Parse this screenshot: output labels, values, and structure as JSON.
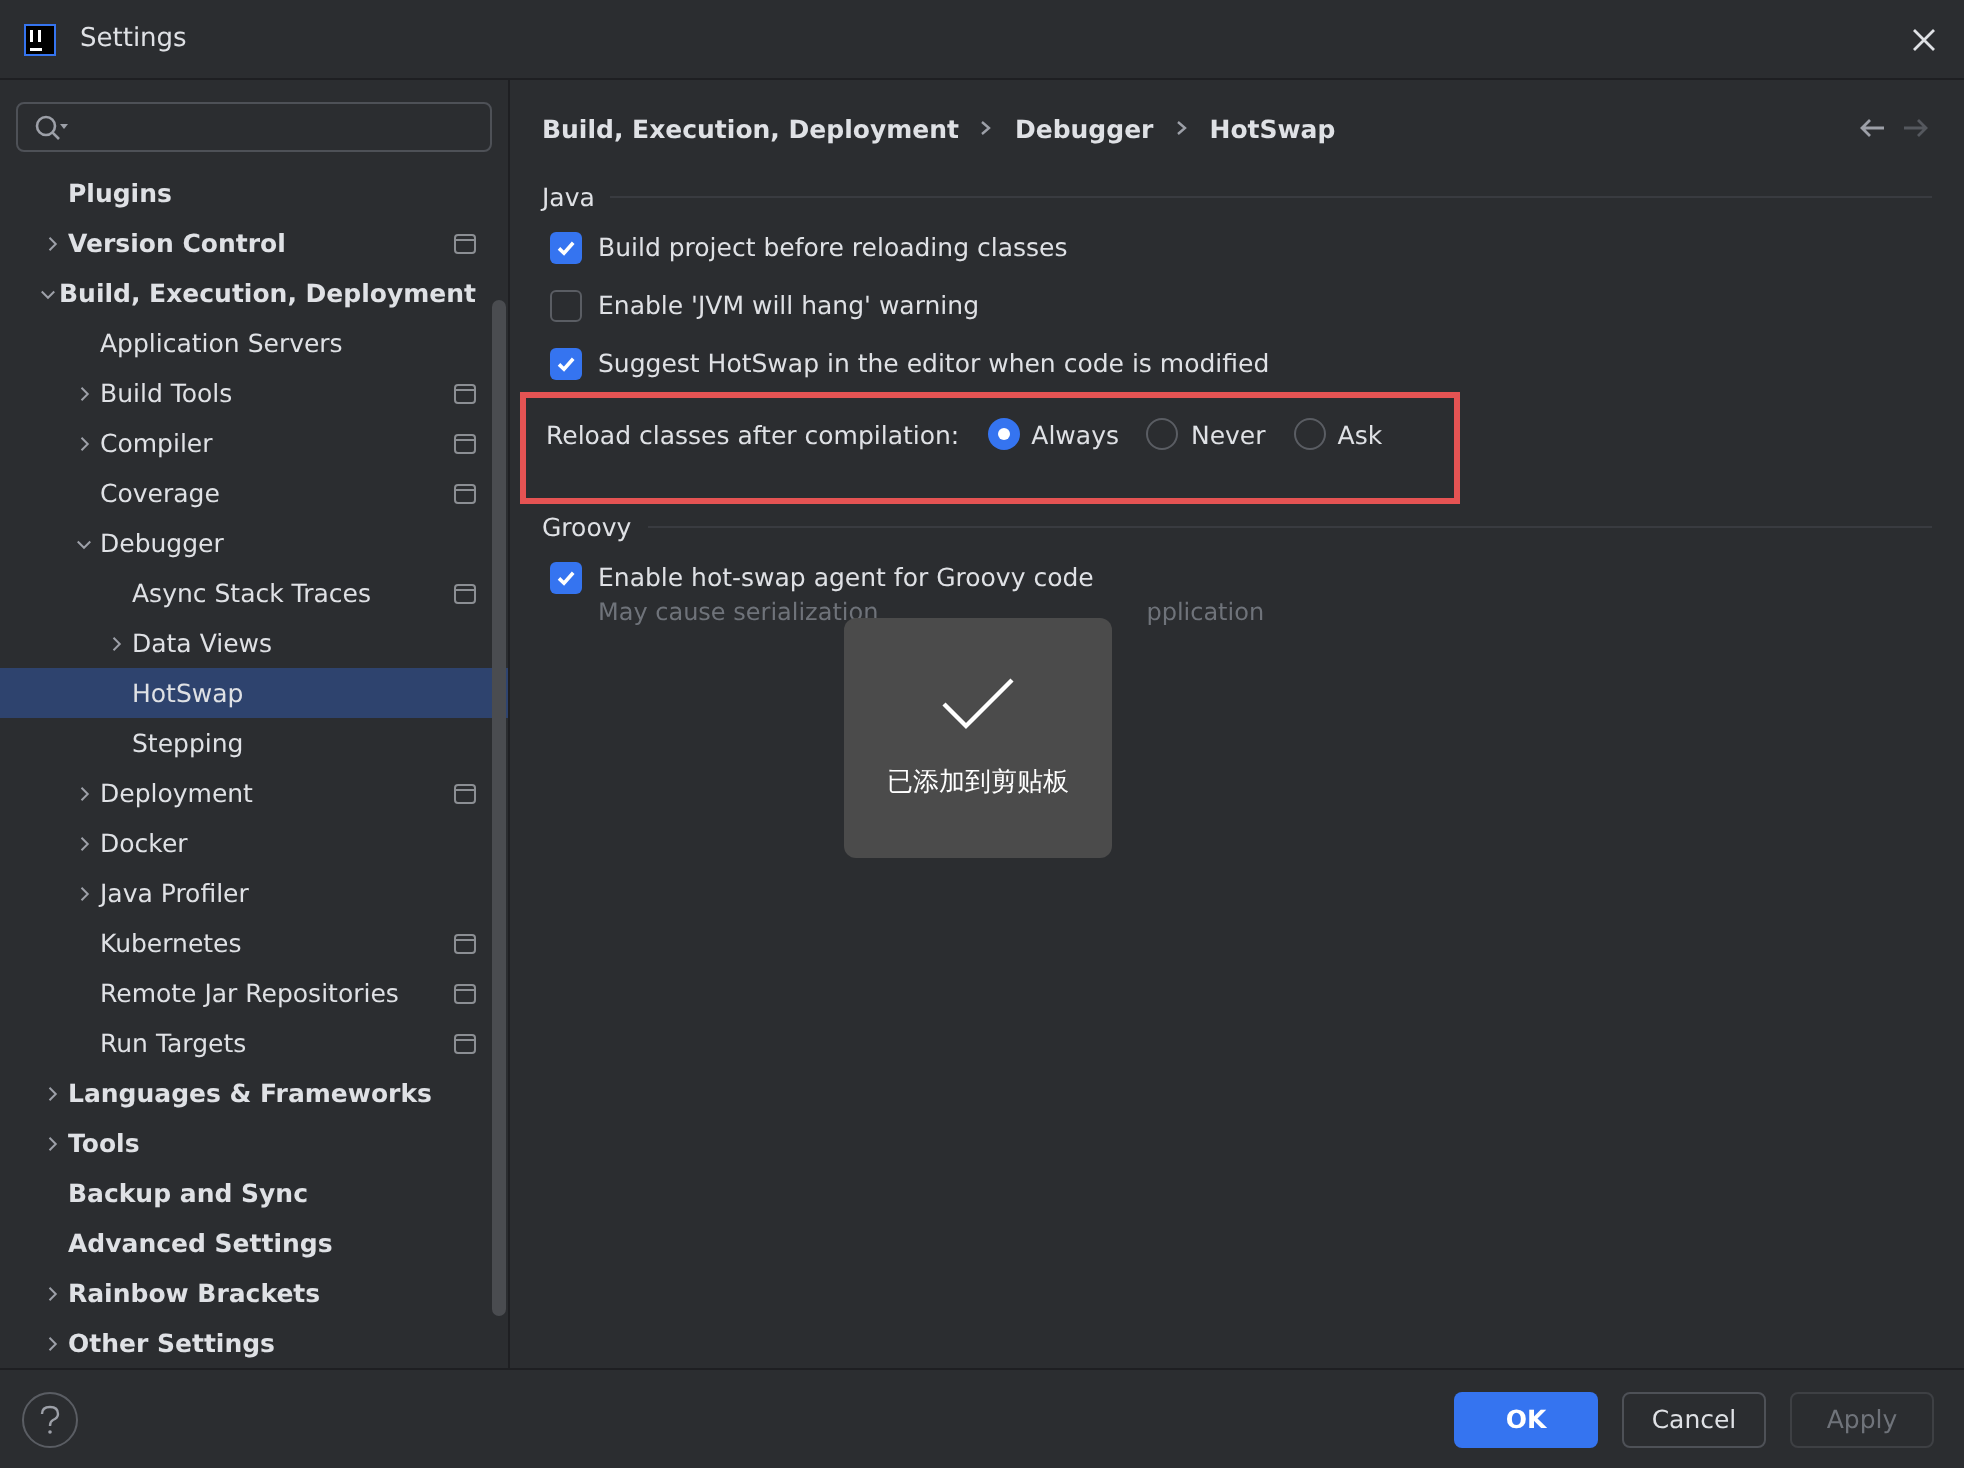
{
  "window": {
    "title": "Settings"
  },
  "sidebar": {
    "items": [
      {
        "label": "Plugins",
        "selected": false
      },
      {
        "label": "Version Control",
        "selected": false,
        "scoped": true,
        "expanded": false
      },
      {
        "label": "Build, Execution, Deployment",
        "selected": false,
        "expanded": true,
        "children": [
          {
            "label": "Application Servers",
            "selected": false
          },
          {
            "label": "Build Tools",
            "selected": false,
            "scoped": true,
            "expanded": false
          },
          {
            "label": "Compiler",
            "selected": false,
            "scoped": true,
            "expanded": false
          },
          {
            "label": "Coverage",
            "selected": false,
            "scoped": true
          },
          {
            "label": "Debugger",
            "selected": false,
            "expanded": true,
            "children": [
              {
                "label": "Async Stack Traces",
                "selected": false,
                "scoped": true
              },
              {
                "label": "Data Views",
                "selected": false,
                "expanded": false
              },
              {
                "label": "HotSwap",
                "selected": true
              },
              {
                "label": "Stepping",
                "selected": false
              }
            ]
          },
          {
            "label": "Deployment",
            "selected": false,
            "scoped": true,
            "expanded": false
          },
          {
            "label": "Docker",
            "selected": false,
            "expanded": false
          },
          {
            "label": "Java Profiler",
            "selected": false,
            "expanded": false
          },
          {
            "label": "Kubernetes",
            "selected": false,
            "scoped": true
          },
          {
            "label": "Remote Jar Repositories",
            "selected": false,
            "scoped": true
          },
          {
            "label": "Run Targets",
            "selected": false,
            "scoped": true
          }
        ]
      },
      {
        "label": "Languages & Frameworks",
        "selected": false,
        "expanded": false
      },
      {
        "label": "Tools",
        "selected": false,
        "expanded": false
      },
      {
        "label": "Backup and Sync",
        "selected": false
      },
      {
        "label": "Advanced Settings",
        "selected": false
      },
      {
        "label": "Rainbow Brackets",
        "selected": false,
        "expanded": false
      },
      {
        "label": "Other Settings",
        "selected": false,
        "expanded": false
      }
    ]
  },
  "breadcrumb": [
    "Build, Execution, Deployment",
    "Debugger",
    "HotSwap"
  ],
  "navigation": {
    "back_disabled": false,
    "forward_disabled": true
  },
  "sections": [
    {
      "title": "Java",
      "options": [
        {
          "kind": "checkbox",
          "label": "Build project before reloading classes",
          "checked": true
        },
        {
          "kind": "checkbox",
          "label": "Enable 'JVM will hang' warning",
          "checked": false
        },
        {
          "kind": "checkbox",
          "label": "Suggest HotSwap in the editor when code is modified",
          "checked": true
        },
        {
          "kind": "radio",
          "label": "Reload classes after compilation:",
          "highlighted": true,
          "choices": [
            {
              "label": "Always",
              "selected": true
            },
            {
              "label": "Never",
              "selected": false
            },
            {
              "label": "Ask",
              "selected": false
            }
          ]
        }
      ]
    },
    {
      "title": "Groovy",
      "options": [
        {
          "kind": "checkbox",
          "label": "Enable hot-swap agent for Groovy code",
          "checked": true,
          "hint_parts": [
            "May cause serialization",
            "pplication"
          ]
        }
      ]
    }
  ],
  "toast": {
    "text": "已添加到剪贴板"
  },
  "buttons": [
    {
      "label": "OK",
      "kind": "primary",
      "disabled": false
    },
    {
      "label": "Cancel",
      "kind": "secondary",
      "disabled": false
    },
    {
      "label": "Apply",
      "kind": "secondary",
      "disabled": true
    }
  ]
}
